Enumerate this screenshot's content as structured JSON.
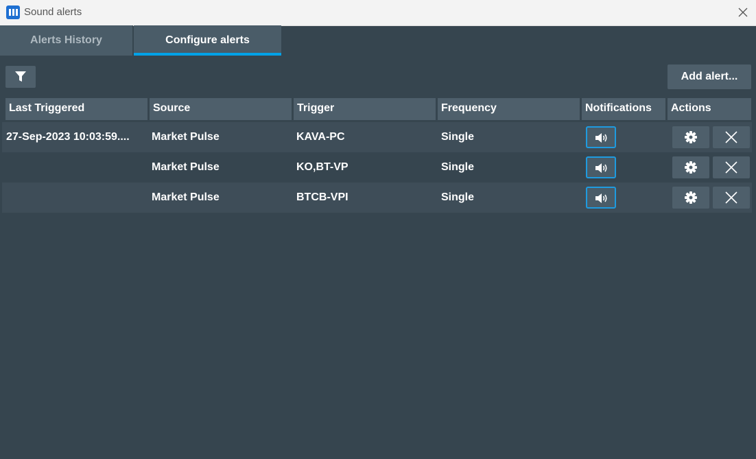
{
  "window": {
    "title": "Sound alerts",
    "app_icon": "app-logo-icon",
    "close_icon": "close-icon"
  },
  "tabs": [
    {
      "label": "Alerts History",
      "active": false
    },
    {
      "label": "Configure alerts",
      "active": true
    }
  ],
  "toolbar": {
    "filter_icon": "filter-icon",
    "add_label": "Add alert..."
  },
  "colors": {
    "accent": "#00a2e8",
    "background": "#36454f",
    "header": "#4e5f6b"
  },
  "table": {
    "headers": [
      "Last Triggered",
      "Source",
      "Trigger",
      "Frequency",
      "Notifications",
      "Actions"
    ],
    "rows": [
      {
        "last_triggered": "27-Sep-2023 10:03:59....",
        "source": "Market Pulse",
        "trigger": "KAVA-PC",
        "frequency": "Single"
      },
      {
        "last_triggered": "",
        "source": "Market Pulse",
        "trigger": "KO,BT-VP",
        "frequency": "Single"
      },
      {
        "last_triggered": "",
        "source": "Market Pulse",
        "trigger": "BTCB-VPI",
        "frequency": "Single"
      }
    ]
  }
}
